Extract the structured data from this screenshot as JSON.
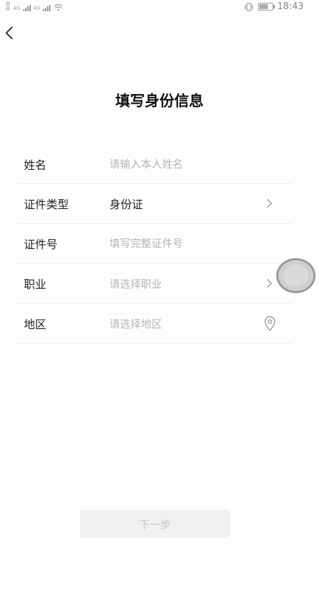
{
  "status": {
    "time": "18:43",
    "sim_labels": [
      "4G",
      "4G"
    ]
  },
  "page": {
    "title": "填写身份信息"
  },
  "form": {
    "rows": [
      {
        "label": "姓名",
        "placeholder": "请输入本人姓名"
      },
      {
        "label": "证件类型",
        "value": "身份证"
      },
      {
        "label": "证件号",
        "placeholder": "填写完整证件号"
      },
      {
        "label": "职业",
        "placeholder": "请选择职业"
      },
      {
        "label": "地区",
        "placeholder": "请选择地区"
      }
    ]
  },
  "footer": {
    "next_label": "下一步"
  },
  "icons": {
    "back": "chevron-left-icon",
    "select": "chevron-right-icon",
    "location": "location-pin-icon"
  },
  "colors": {
    "background": "#fdfdfd",
    "placeholder": "#b5b5b5",
    "divider": "#ececec",
    "button_disabled_bg": "#f1f1f1",
    "button_disabled_text": "#c2c2c2"
  }
}
